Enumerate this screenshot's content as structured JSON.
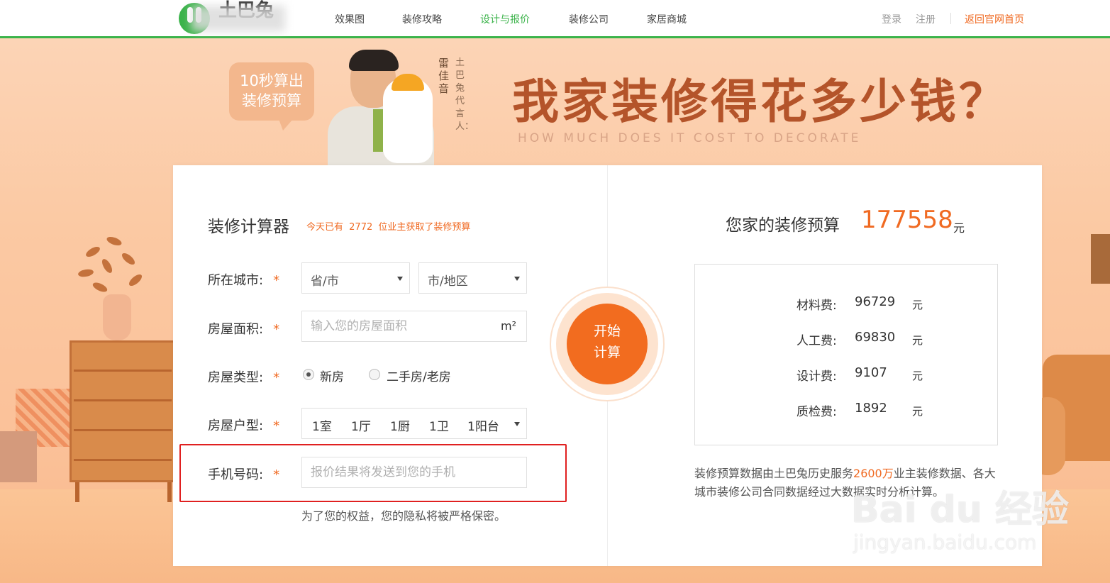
{
  "nav": {
    "logo_text": "土巴兔",
    "items": [
      "效果图",
      "装修攻略",
      "设计与报价",
      "装修公司",
      "家居商城"
    ],
    "active_index": 2,
    "login": "登录",
    "register": "注册",
    "home_link": "返回官网首页"
  },
  "banner": {
    "speech_line1": "10秒算出",
    "speech_line2": "装修预算",
    "spokesperson_col1": "雷佳音",
    "spokesperson_col2": "土巴兔代言人：",
    "headline": "我家装修得花多少钱？",
    "subline": "HOW MUCH DOES IT COST TO DECORATE"
  },
  "calculator": {
    "title": "装修计算器",
    "subtitle_prefix": "今天已有",
    "count": "2772",
    "subtitle_suffix": "位业主获取了装修预算",
    "required_mark": "*",
    "city_label": "所在城市:",
    "province_value": "省/市",
    "city_value": "市/地区",
    "area_label": "房屋面积:",
    "area_placeholder": "输入您的房屋面积",
    "area_unit": "m²",
    "type_label": "房屋类型:",
    "type_options": [
      "新房",
      "二手房/老房"
    ],
    "type_selected": 0,
    "layout_label": "房屋户型:",
    "layout_values": [
      "1室",
      "1厅",
      "1厨",
      "1卫",
      "1阳台"
    ],
    "phone_label": "手机号码:",
    "phone_placeholder": "报价结果将发送到您的手机",
    "privacy_note": "为了您的权益，您的隐私将被严格保密。",
    "start_line1": "开始",
    "start_line2": "计算"
  },
  "result": {
    "title": "您家的装修预算",
    "total": "177558",
    "unit": "元",
    "fees": [
      {
        "label": "材料费:",
        "value": "96729",
        "unit": "元"
      },
      {
        "label": "人工费:",
        "value": "69830",
        "unit": "元"
      },
      {
        "label": "设计费:",
        "value": "9107",
        "unit": "元"
      },
      {
        "label": "质检费:",
        "value": "1892",
        "unit": "元"
      }
    ],
    "note_prefix": "装修预算数据由土巴兔历史服务",
    "note_highlight": "2600万",
    "note_suffix": "业主装修数据、各大城市装修公司合同数据经过大数据实时分析计算。"
  },
  "watermark": {
    "brand": "Bai du 经验",
    "url": "jingyan.baidu.com"
  },
  "colors": {
    "brand_green": "#3bb34a",
    "accent_orange": "#f06a22",
    "highlight_red": "#e02020"
  }
}
